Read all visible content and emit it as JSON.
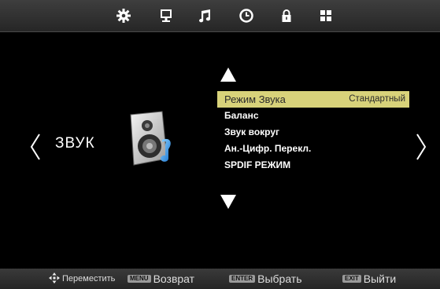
{
  "topbar": {
    "tabs": [
      {
        "icon": "gear-icon"
      },
      {
        "icon": "monitor-icon"
      },
      {
        "icon": "music-note-icon"
      },
      {
        "icon": "clock-icon"
      },
      {
        "icon": "lock-icon"
      },
      {
        "icon": "grid-icon"
      }
    ]
  },
  "section": {
    "title": "ЗВУК",
    "icon": "speaker-icon"
  },
  "menu": {
    "items": [
      {
        "label": "Режим Звука",
        "value": "Стандартный",
        "selected": true
      },
      {
        "label": "Баланс"
      },
      {
        "label": "Звук вокруг"
      },
      {
        "label": "Ан.-Цифр. Перекл."
      },
      {
        "label": "SPDIF РЕЖИМ"
      }
    ]
  },
  "footer": {
    "move_label": "Переместить",
    "menu_key": "MENU",
    "back_label": "Возврат",
    "enter_key": "ENTER",
    "select_label": "Выбрать",
    "exit_key": "EXIT",
    "exit_label": "Выйти"
  },
  "colors": {
    "selection": "#d8d27a",
    "background": "#000000",
    "bar": "#2e2e2e"
  }
}
